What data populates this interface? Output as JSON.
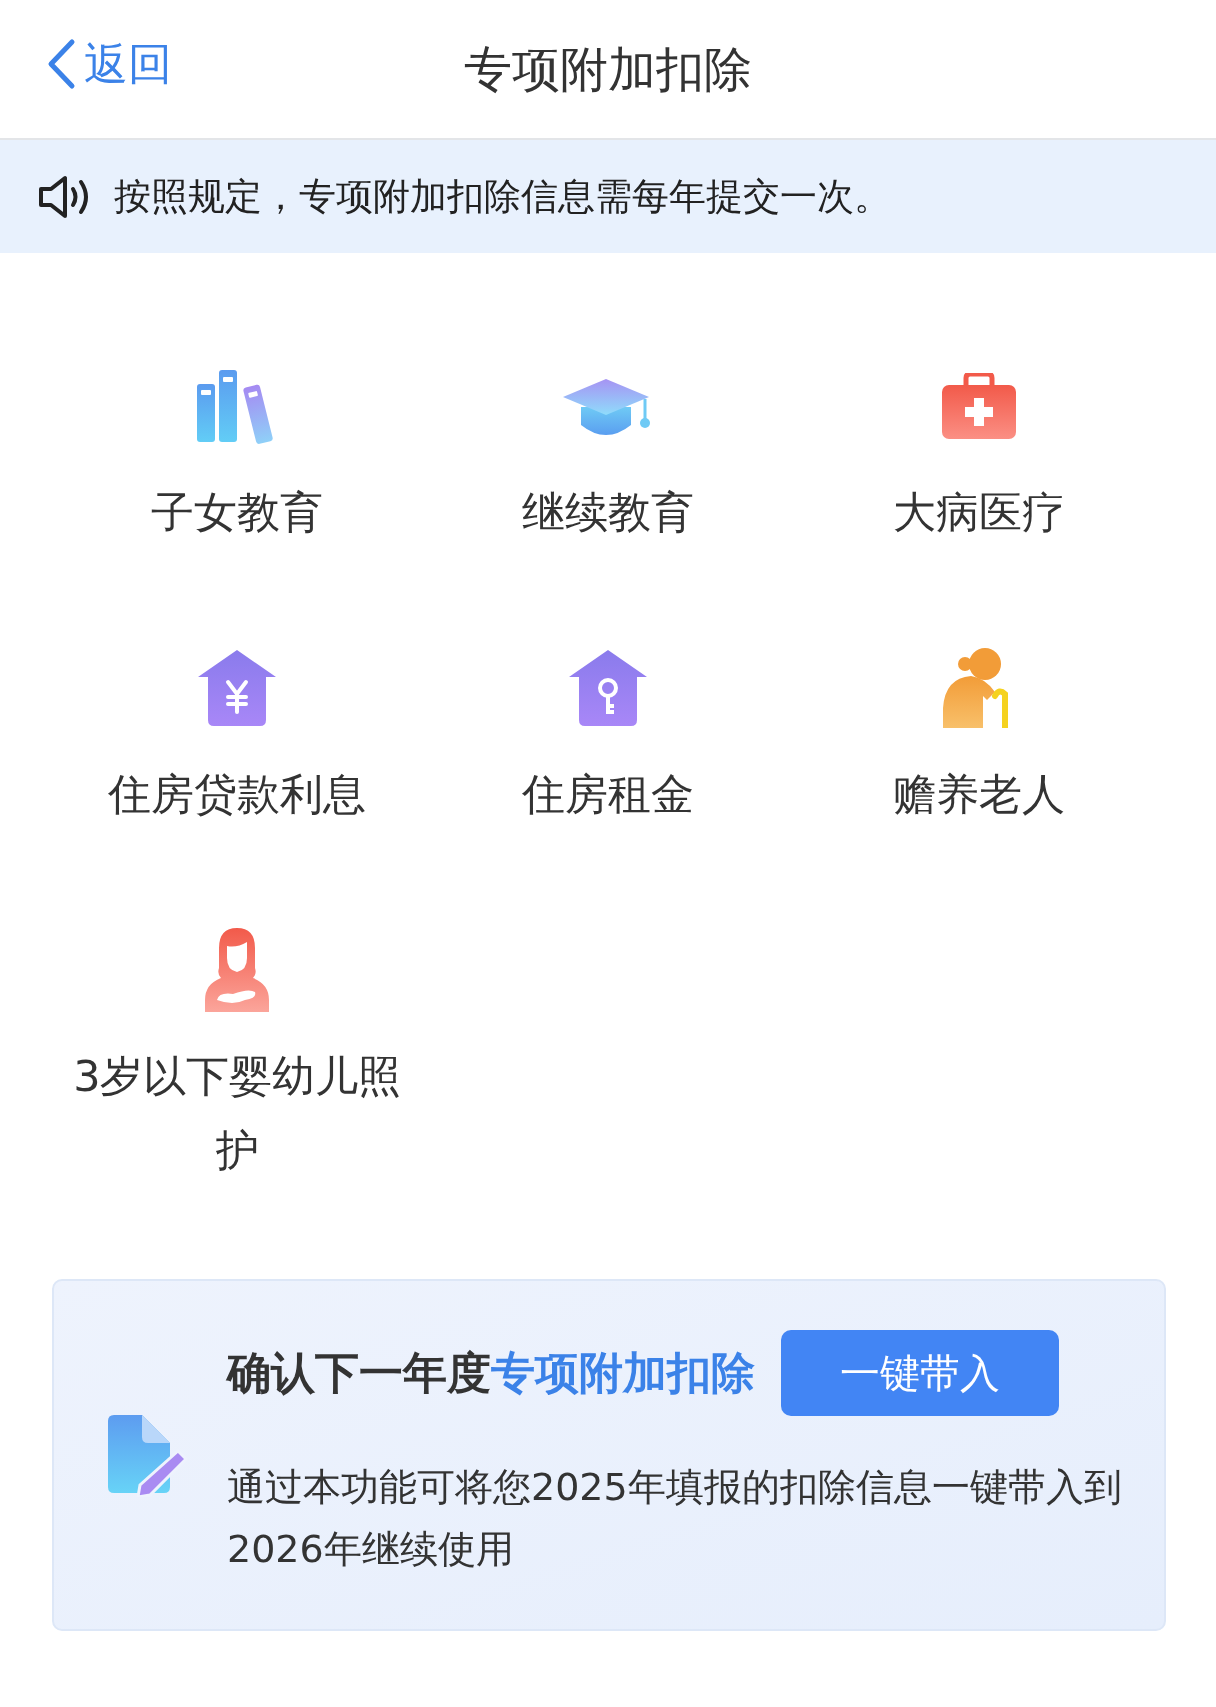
{
  "header": {
    "back_label": "返回",
    "title": "专项附加扣除"
  },
  "notice": {
    "text": "按照规定，专项附加扣除信息需每年提交一次。"
  },
  "categories": [
    {
      "kind": "books",
      "label": "子女教育"
    },
    {
      "kind": "cap",
      "label": "继续教育"
    },
    {
      "kind": "medkit",
      "label": "大病医疗"
    },
    {
      "kind": "house_yuan",
      "label": "住房贷款利息"
    },
    {
      "kind": "house_key",
      "label": "住房租金"
    },
    {
      "kind": "elder",
      "label": "赡养老人"
    },
    {
      "kind": "mother",
      "label": "3岁以下婴幼儿照护"
    }
  ],
  "card": {
    "title_prefix": "确认下一年度",
    "title_highlight": "专项附加扣除",
    "button": "一键带入",
    "description": "通过本功能可将您2025年填报的扣除信息一键带入到2026年继续使用"
  }
}
